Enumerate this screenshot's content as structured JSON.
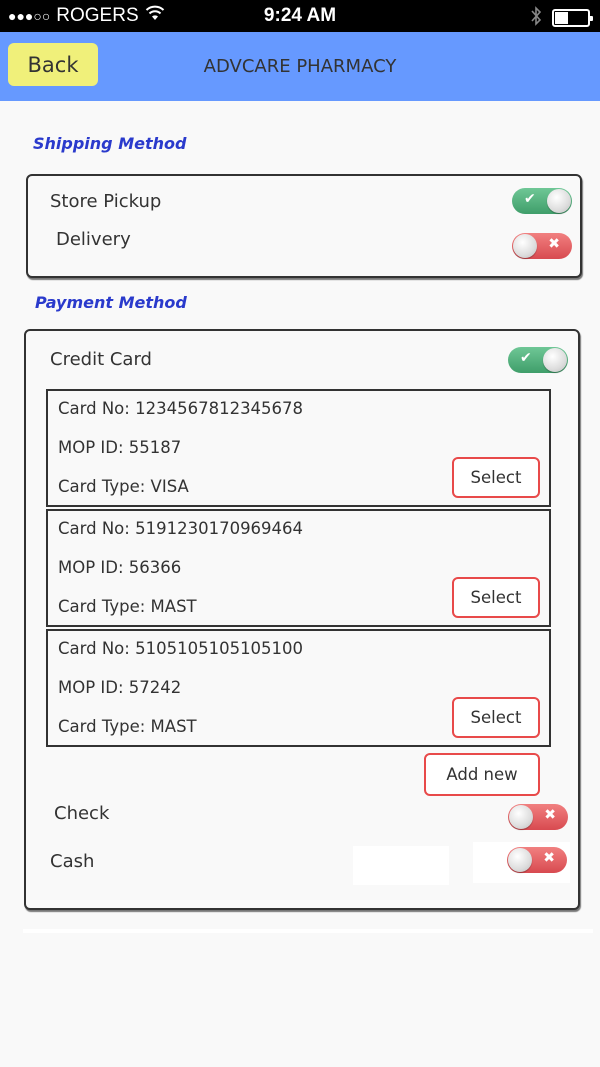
{
  "status_bar": {
    "signal": "●●●○○",
    "carrier": "ROGERS",
    "wifi_icon": "wifi-icon",
    "time": "9:24 AM",
    "bluetooth_icon": "bluetooth-icon",
    "battery_level": 0.4
  },
  "header": {
    "back_label": "Back",
    "title": "ADVCARE PHARMACY"
  },
  "shipping": {
    "section_label": "Shipping Method",
    "options": [
      {
        "label": "Store Pickup",
        "enabled": true
      },
      {
        "label": "Delivery",
        "enabled": false
      }
    ]
  },
  "payment": {
    "section_label": "Payment Method",
    "credit_card": {
      "label": "Credit Card",
      "enabled": true
    },
    "cards": [
      {
        "card_no": "Card No: 1234567812345678",
        "mop_id": "MOP ID: 55187",
        "card_type": "Card Type: VISA",
        "select_label": "Select"
      },
      {
        "card_no": "Card No: 5191230170969464",
        "mop_id": "MOP ID: 56366",
        "card_type": "Card Type: MAST",
        "select_label": "Select"
      },
      {
        "card_no": "Card No: 5105105105105100",
        "mop_id": "MOP ID: 57242",
        "card_type": "Card Type: MAST",
        "select_label": "Select"
      }
    ],
    "add_new_label": "Add new",
    "check": {
      "label": "Check",
      "enabled": false
    },
    "cash": {
      "label": "Cash",
      "enabled": false
    }
  },
  "colors": {
    "header_bg": "#6699ff",
    "back_button_bg": "#f0f07a",
    "section_label": "#2a3acc",
    "toggle_on": "#4caf7a",
    "toggle_off": "#e05a60",
    "button_border": "#e84a4a"
  },
  "toggle_glyphs": {
    "on": "✔",
    "off": "✖"
  }
}
